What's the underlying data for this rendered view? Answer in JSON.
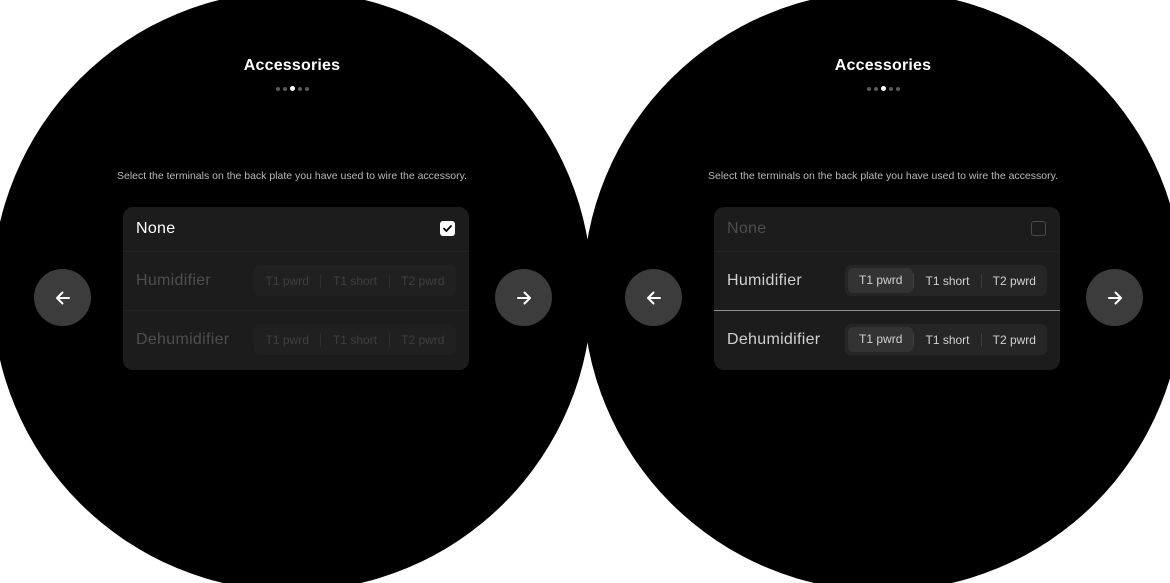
{
  "screens": [
    {
      "title": "Accessories",
      "pager": {
        "total": 5,
        "active": 2
      },
      "instructions": "Select the terminals on the back plate you have used to wire the accessory.",
      "none_row": {
        "label": "None",
        "checked": true
      },
      "humidifier": {
        "label": "Humidifier",
        "options": [
          "T1 pwrd",
          "T1 short",
          "T2 pwrd"
        ],
        "enabled": false
      },
      "dehumidifier": {
        "label": "Dehumidifier",
        "options": [
          "T1 pwrd",
          "T1 short",
          "T2 pwrd"
        ],
        "enabled": false
      },
      "icons": {
        "back": "arrow-left-icon",
        "next": "arrow-right-icon",
        "check": "checkmark-icon"
      }
    },
    {
      "title": "Accessories",
      "pager": {
        "total": 5,
        "active": 2
      },
      "instructions": "Select the terminals on the back plate you have used to wire the accessory.",
      "none_row": {
        "label": "None",
        "checked": false
      },
      "humidifier": {
        "label": "Humidifier",
        "options": [
          "T1 pwrd",
          "T1 short",
          "T2 pwrd"
        ],
        "enabled": true
      },
      "dehumidifier": {
        "label": "Dehumidifier",
        "options": [
          "T1 pwrd",
          "T1 short",
          "T2 pwrd"
        ],
        "enabled": true
      },
      "icons": {
        "back": "arrow-left-icon",
        "next": "arrow-right-icon"
      }
    }
  ],
  "colors": {
    "screen_bg": "#000000",
    "card_bg": "#1c1c1c",
    "button_bg": "#3c3c3c",
    "text_primary": "#ffffff",
    "text_disabled": "#4e4e4e"
  }
}
